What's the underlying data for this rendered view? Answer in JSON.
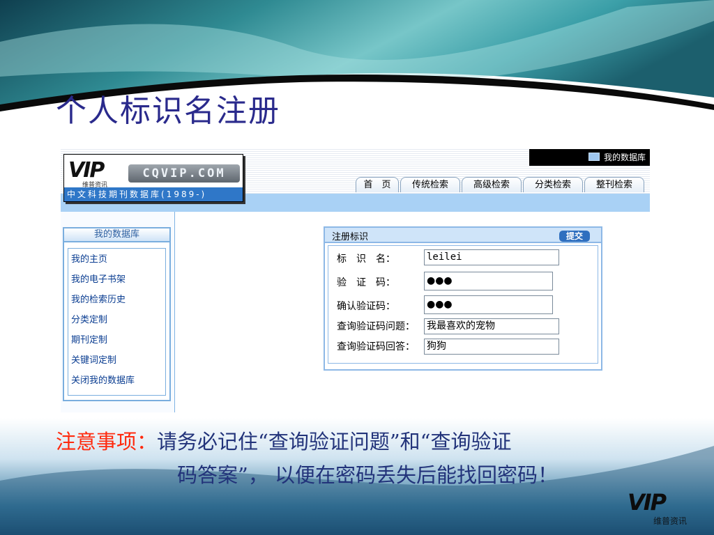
{
  "slide": {
    "title": "个人标识名注册",
    "note": {
      "label": "注意事项：",
      "line1": "请务必记住“查询验证问题”和“查询验证",
      "line2": "码答案”， 以便在密码丢失后能找回密码！"
    },
    "brand": {
      "logo_text": "VIP",
      "caption": "维普资讯"
    }
  },
  "screenshot": {
    "header": {
      "logo": {
        "text": "VIP",
        "caption": "维普资讯",
        "url_text": "CQVIP.COM",
        "subtitle": "中文科技期刊数据库(1989-)"
      },
      "my_database_link": "我的数据库",
      "tabs": [
        "首　页",
        "传统检索",
        "高级检索",
        "分类检索",
        "整刊检索"
      ]
    },
    "sidebar": {
      "title": "我的数据库",
      "items": [
        "我的主页",
        "我的电子书架",
        "我的检索历史",
        "分类定制",
        "期刊定制",
        "关键词定制",
        "关闭我的数据库"
      ]
    },
    "registration": {
      "title": "注册标识",
      "submit_label": "提交",
      "fields": [
        {
          "label": "标　识　名：",
          "value": "leilei"
        },
        {
          "label": "验　证　码：",
          "value": "●●●"
        },
        {
          "label": "确认验证码：",
          "value": "●●●"
        },
        {
          "label": "查询验证码问题：",
          "value": "我最喜欢的宠物"
        },
        {
          "label": "查询验证码回答：",
          "value": "狗狗"
        }
      ]
    }
  },
  "colors": {
    "title": "#2a2a8c",
    "note_label": "#ff2a0e",
    "note_text": "#22337a",
    "link": "#0a3d91",
    "accent_blue": "#2f6fbf"
  }
}
